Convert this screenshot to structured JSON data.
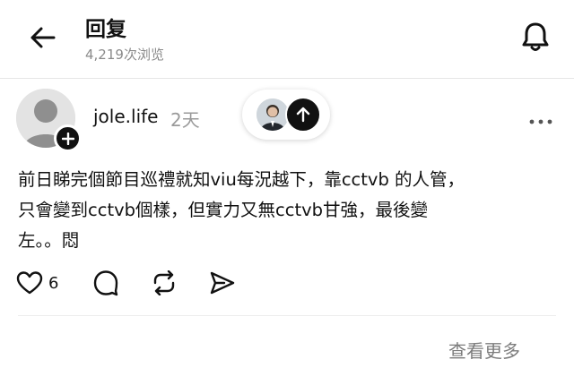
{
  "header": {
    "title": "回复",
    "views": "4,219次浏览",
    "back_icon": "arrow-left-icon",
    "bell_icon": "bell-icon"
  },
  "post": {
    "username": "jole.life",
    "time": "2天",
    "text": "前日睇完個節目巡禮就知viu每況越下，靠cctvb 的人管，\n只會變到cctvb個樣，但實力又無cctvb甘強，最後變\n左。。悶",
    "likes": "6"
  },
  "icons": {
    "heart": "heart-icon",
    "comment": "comment-icon",
    "repost": "repost-icon",
    "share": "send-icon",
    "more": "more-dots-icon",
    "follow": "plus-icon",
    "up": "arrow-up-icon"
  },
  "watermark": "查看更多",
  "colors": {
    "text": "#111111",
    "muted": "#8a8a8a",
    "accent": "#111111"
  }
}
